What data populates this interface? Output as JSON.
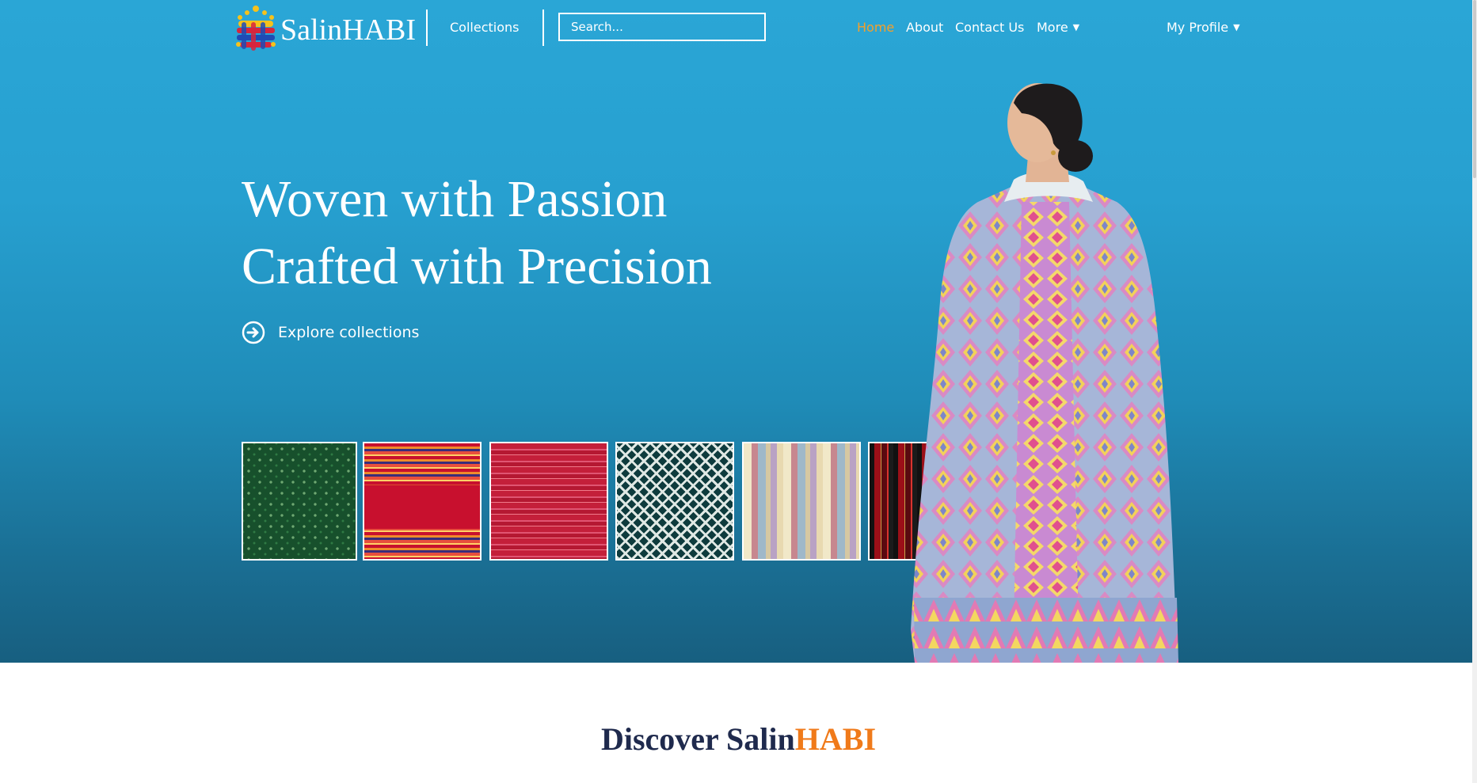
{
  "brand": {
    "name": "SalinHABI"
  },
  "nav": {
    "collections": "Collections",
    "search_placeholder": "Search...",
    "links": [
      {
        "label": "Home",
        "active": true
      },
      {
        "label": "About"
      },
      {
        "label": "Contact Us"
      },
      {
        "label": "More",
        "icon": "chevron-down-icon"
      }
    ],
    "profile": "My Profile"
  },
  "hero": {
    "line1": "Woven with Passion",
    "line2": "Crafted with Precision",
    "cta": "Explore collections"
  },
  "swatches": [
    "green-dotted-weave",
    "red-striped-weave",
    "red-pinstripe-weave",
    "teal-diamond-weave",
    "pastel-vertical-stripes",
    "black-red-vertical-stripes"
  ],
  "discover": {
    "part1": "Discover Salin",
    "part2": "HABI"
  },
  "colors": {
    "accent": "#f5a02a",
    "hero": "#27a0d0",
    "discover_dark": "#1f2a4d",
    "discover_orange": "#f07a1a"
  }
}
